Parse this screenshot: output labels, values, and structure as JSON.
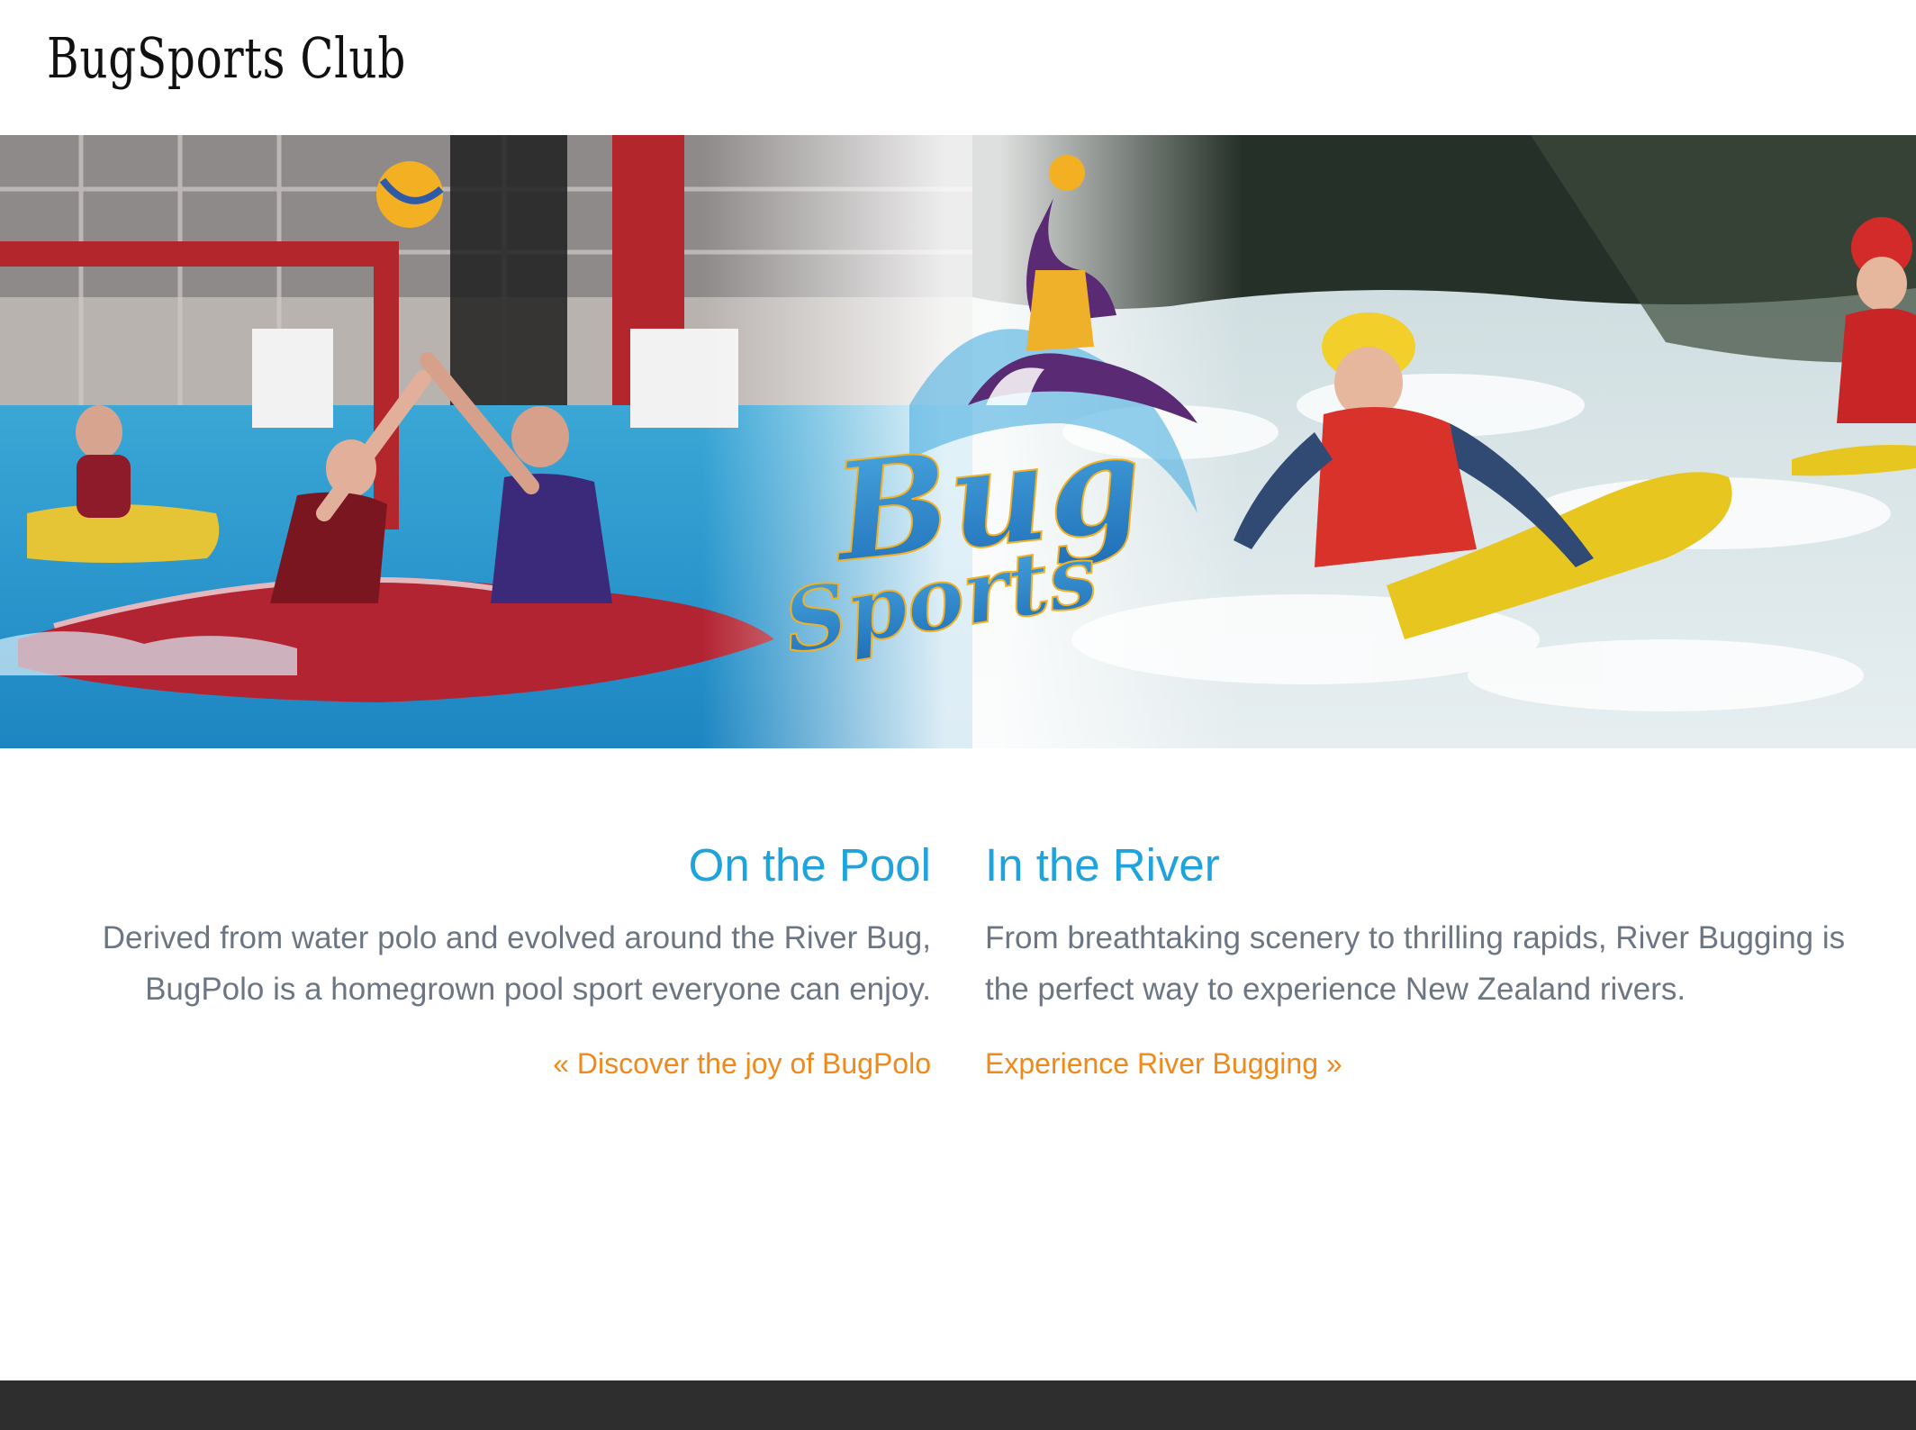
{
  "site": {
    "title": "BugSports Club"
  },
  "hero": {
    "logo_top": "Bug",
    "logo_bottom": "Sports"
  },
  "columns": [
    {
      "heading": "On the Pool",
      "body": "Derived from water polo and evolved around the River Bug, BugPolo is a homegrown pool sport everyone can enjoy.",
      "link": "« Discover the joy of BugPolo"
    },
    {
      "heading": "In the River",
      "body": "From breathtaking scenery to thrilling rapids, River Bugging is the perfect way to experience New Zealand rivers.",
      "link": "Experience River Bugging »"
    }
  ],
  "colors": {
    "heading": "#1fa3dd",
    "body_text": "#6c7682",
    "link": "#f0891a",
    "footer": "#2e2e2e"
  }
}
